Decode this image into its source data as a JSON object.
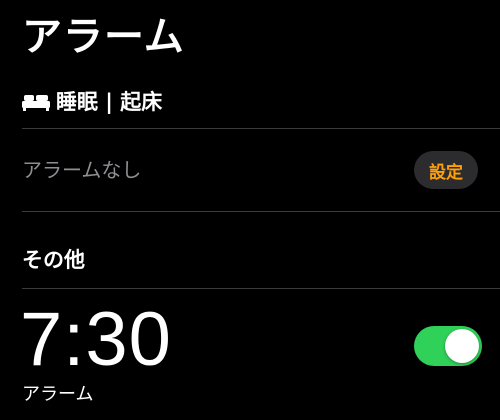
{
  "header": {
    "title": "アラーム"
  },
  "sleep_section": {
    "icon": "bed-icon",
    "title": "睡眠 | 起床",
    "status_text": "アラームなし",
    "set_button_label": "設定"
  },
  "other_section": {
    "title": "その他",
    "alarms": [
      {
        "time": "7:30",
        "label": "アラーム",
        "enabled": true
      }
    ]
  },
  "colors": {
    "background": "#000000",
    "accent_orange": "#ff9f0a",
    "toggle_on_green": "#30d158",
    "secondary_text": "#8e8e93",
    "divider": "#3a3a3c",
    "button_background": "#2c2c2e"
  }
}
